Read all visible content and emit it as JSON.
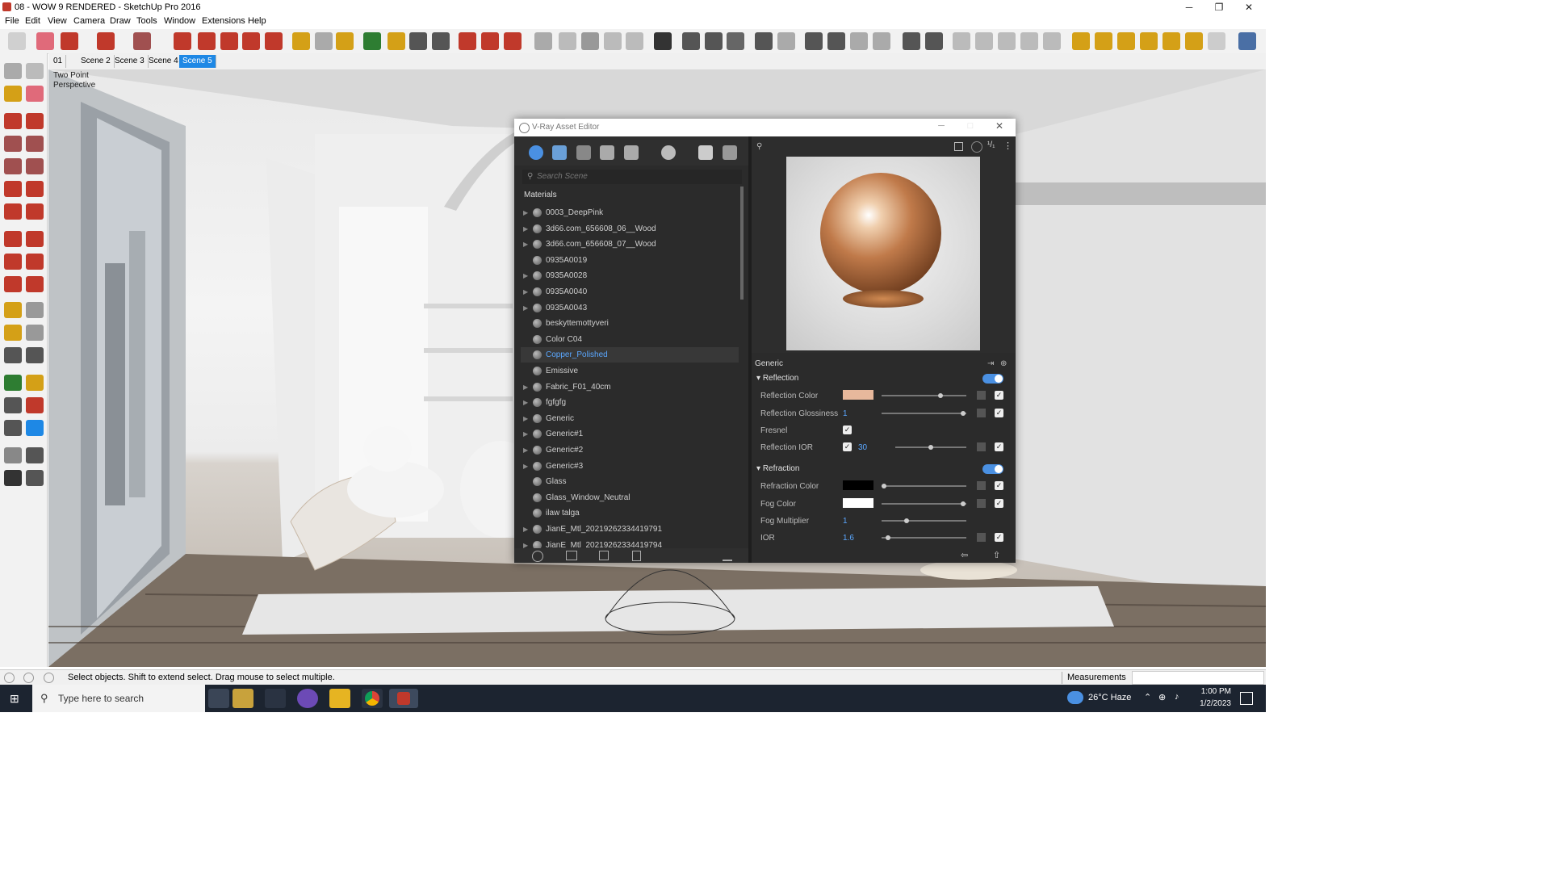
{
  "window": {
    "title": "08 - WOW 9 RENDERED - SketchUp Pro 2016",
    "minimize": "─",
    "maximize": "❐",
    "close": "✕"
  },
  "menu": [
    "File",
    "Edit",
    "View",
    "Camera",
    "Draw",
    "Tools",
    "Window",
    "Extensions",
    "Help"
  ],
  "scenes": {
    "tabs": [
      "01",
      "Scene 2",
      "Scene 3",
      "Scene 4",
      "Scene 5"
    ],
    "active": "Scene 5"
  },
  "viewport": {
    "camera_label": "Two Point\nPerspective"
  },
  "vray": {
    "title": "V-Ray Asset Editor",
    "search_placeholder": "Search Scene",
    "materials_header": "Materials",
    "materials": [
      {
        "name": "0003_DeepPink",
        "expand": true
      },
      {
        "name": "3d66.com_656608_06__Wood",
        "expand": true
      },
      {
        "name": "3d66.com_656608_07__Wood",
        "expand": true
      },
      {
        "name": "0935A0019",
        "expand": false
      },
      {
        "name": "0935A0028",
        "expand": true
      },
      {
        "name": "0935A0040",
        "expand": true
      },
      {
        "name": "0935A0043",
        "expand": true
      },
      {
        "name": "beskyttemottyveri",
        "expand": false
      },
      {
        "name": "Color C04",
        "expand": false
      },
      {
        "name": "Copper_Polished",
        "expand": false,
        "selected": true
      },
      {
        "name": "Emissive",
        "expand": false
      },
      {
        "name": "Fabric_F01_40cm",
        "expand": true
      },
      {
        "name": "fgfgfg",
        "expand": true
      },
      {
        "name": "Generic",
        "expand": true
      },
      {
        "name": "Generic#1",
        "expand": true
      },
      {
        "name": "Generic#2",
        "expand": true
      },
      {
        "name": "Generic#3",
        "expand": true
      },
      {
        "name": "Glass",
        "expand": false
      },
      {
        "name": "Glass_Window_Neutral",
        "expand": false
      },
      {
        "name": "ilaw talga",
        "expand": false
      },
      {
        "name": "JianE_Mtl_20219262334419791",
        "expand": true
      },
      {
        "name": "JianE_Mtl_20219262334419794",
        "expand": true
      }
    ],
    "panel_title": "Generic",
    "reflection": {
      "header": "Reflection",
      "color_label": "Reflection Color",
      "color": "#e7b89c",
      "gloss_label": "Reflection Glossiness",
      "gloss_value": "1",
      "fresnel_label": "Fresnel",
      "ior_label": "Reflection IOR",
      "ior_value": "30"
    },
    "refraction": {
      "header": "Refraction",
      "color_label": "Refraction Color",
      "color": "#000000",
      "fog_color_label": "Fog Color",
      "fog_color": "#ffffff",
      "fog_mult_label": "Fog Multiplier",
      "fog_mult_value": "1",
      "ior_label": "IOR",
      "ior_value": "1.6"
    }
  },
  "status": {
    "message": "Select objects. Shift to extend select. Drag mouse to select multiple.",
    "measurements_label": "Measurements"
  },
  "taskbar": {
    "search_placeholder": "Type here to search",
    "weather": "26°C  Haze",
    "time": "1:00 PM",
    "date": "1/2/2023"
  },
  "colors": {
    "accent": "#1e88e5",
    "vray_link": "#5aa7ff"
  }
}
